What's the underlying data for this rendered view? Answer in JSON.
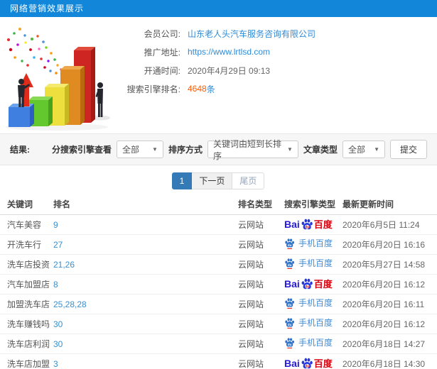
{
  "window": {
    "title": "网络营销效果展示"
  },
  "info": {
    "fields": [
      {
        "label": "会员公司:",
        "value": "山东老人头汽车服务咨询有限公司"
      },
      {
        "label": "推广地址:",
        "value": "https://www.lrtlsd.com"
      },
      {
        "label": "开通时间:",
        "value": "2020年4月29日 09:13"
      },
      {
        "label": "搜索引擎排名:",
        "value": "4648",
        "suffix": "条"
      }
    ]
  },
  "filters": {
    "result_label": "结果:",
    "engine_label": "分搜索引擎查看",
    "engine_value": "全部",
    "sort_label": "排序方式",
    "sort_value": "关键词由短到长排序",
    "article_label": "文章类型",
    "article_value": "全部",
    "submit_label": "提交",
    "caret": "▼"
  },
  "pagination": {
    "current": "1",
    "next_label": "下一页",
    "last_label": "尾页"
  },
  "table": {
    "headers": [
      "关键词",
      "排名",
      "排名类型",
      "搜索引擎类型",
      "最新更新时间"
    ],
    "rows": [
      {
        "keyword": "汽车美容",
        "rank": "9",
        "rank_type": "云网站",
        "engine": "baidu",
        "time": "2020年6月5日 11:24"
      },
      {
        "keyword": "开洗车行",
        "rank": "27",
        "rank_type": "云网站",
        "engine": "mobile-baidu",
        "time": "2020年6月20日 16:16"
      },
      {
        "keyword": "洗车店投资",
        "rank": "21,26",
        "rank_type": "云网站",
        "engine": "mobile-baidu",
        "time": "2020年5月27日 14:58"
      },
      {
        "keyword": "汽车加盟店",
        "rank": "8",
        "rank_type": "云网站",
        "engine": "baidu",
        "time": "2020年6月20日 16:12"
      },
      {
        "keyword": "加盟洗车店",
        "rank": "25,28,28",
        "rank_type": "云网站",
        "engine": "mobile-baidu",
        "time": "2020年6月20日 16:11"
      },
      {
        "keyword": "洗车赚钱吗",
        "rank": "30",
        "rank_type": "云网站",
        "engine": "mobile-baidu",
        "time": "2020年6月20日 16:12"
      },
      {
        "keyword": "洗车店利润",
        "rank": "30",
        "rank_type": "云网站",
        "engine": "mobile-baidu",
        "time": "2020年6月18日 14:27"
      },
      {
        "keyword": "洗车店加盟",
        "rank": "3",
        "rank_type": "云网站",
        "engine": "baidu",
        "time": "2020年6月18日 14:30"
      }
    ]
  },
  "logos": {
    "baidu_latin": "Bai",
    "baidu_du": "du",
    "baidu_cn": "百度",
    "mobile_baidu": "手机百度"
  },
  "colors": {
    "titlebar_bg": "#1287d9",
    "link_blue": "#2f8bd6",
    "count_orange": "#ff5a00",
    "pager_active_bg": "#337ab7",
    "baidu_blue": "#2419dc",
    "baidu_red": "#d8000c",
    "mobile_blue": "#418bd4"
  }
}
